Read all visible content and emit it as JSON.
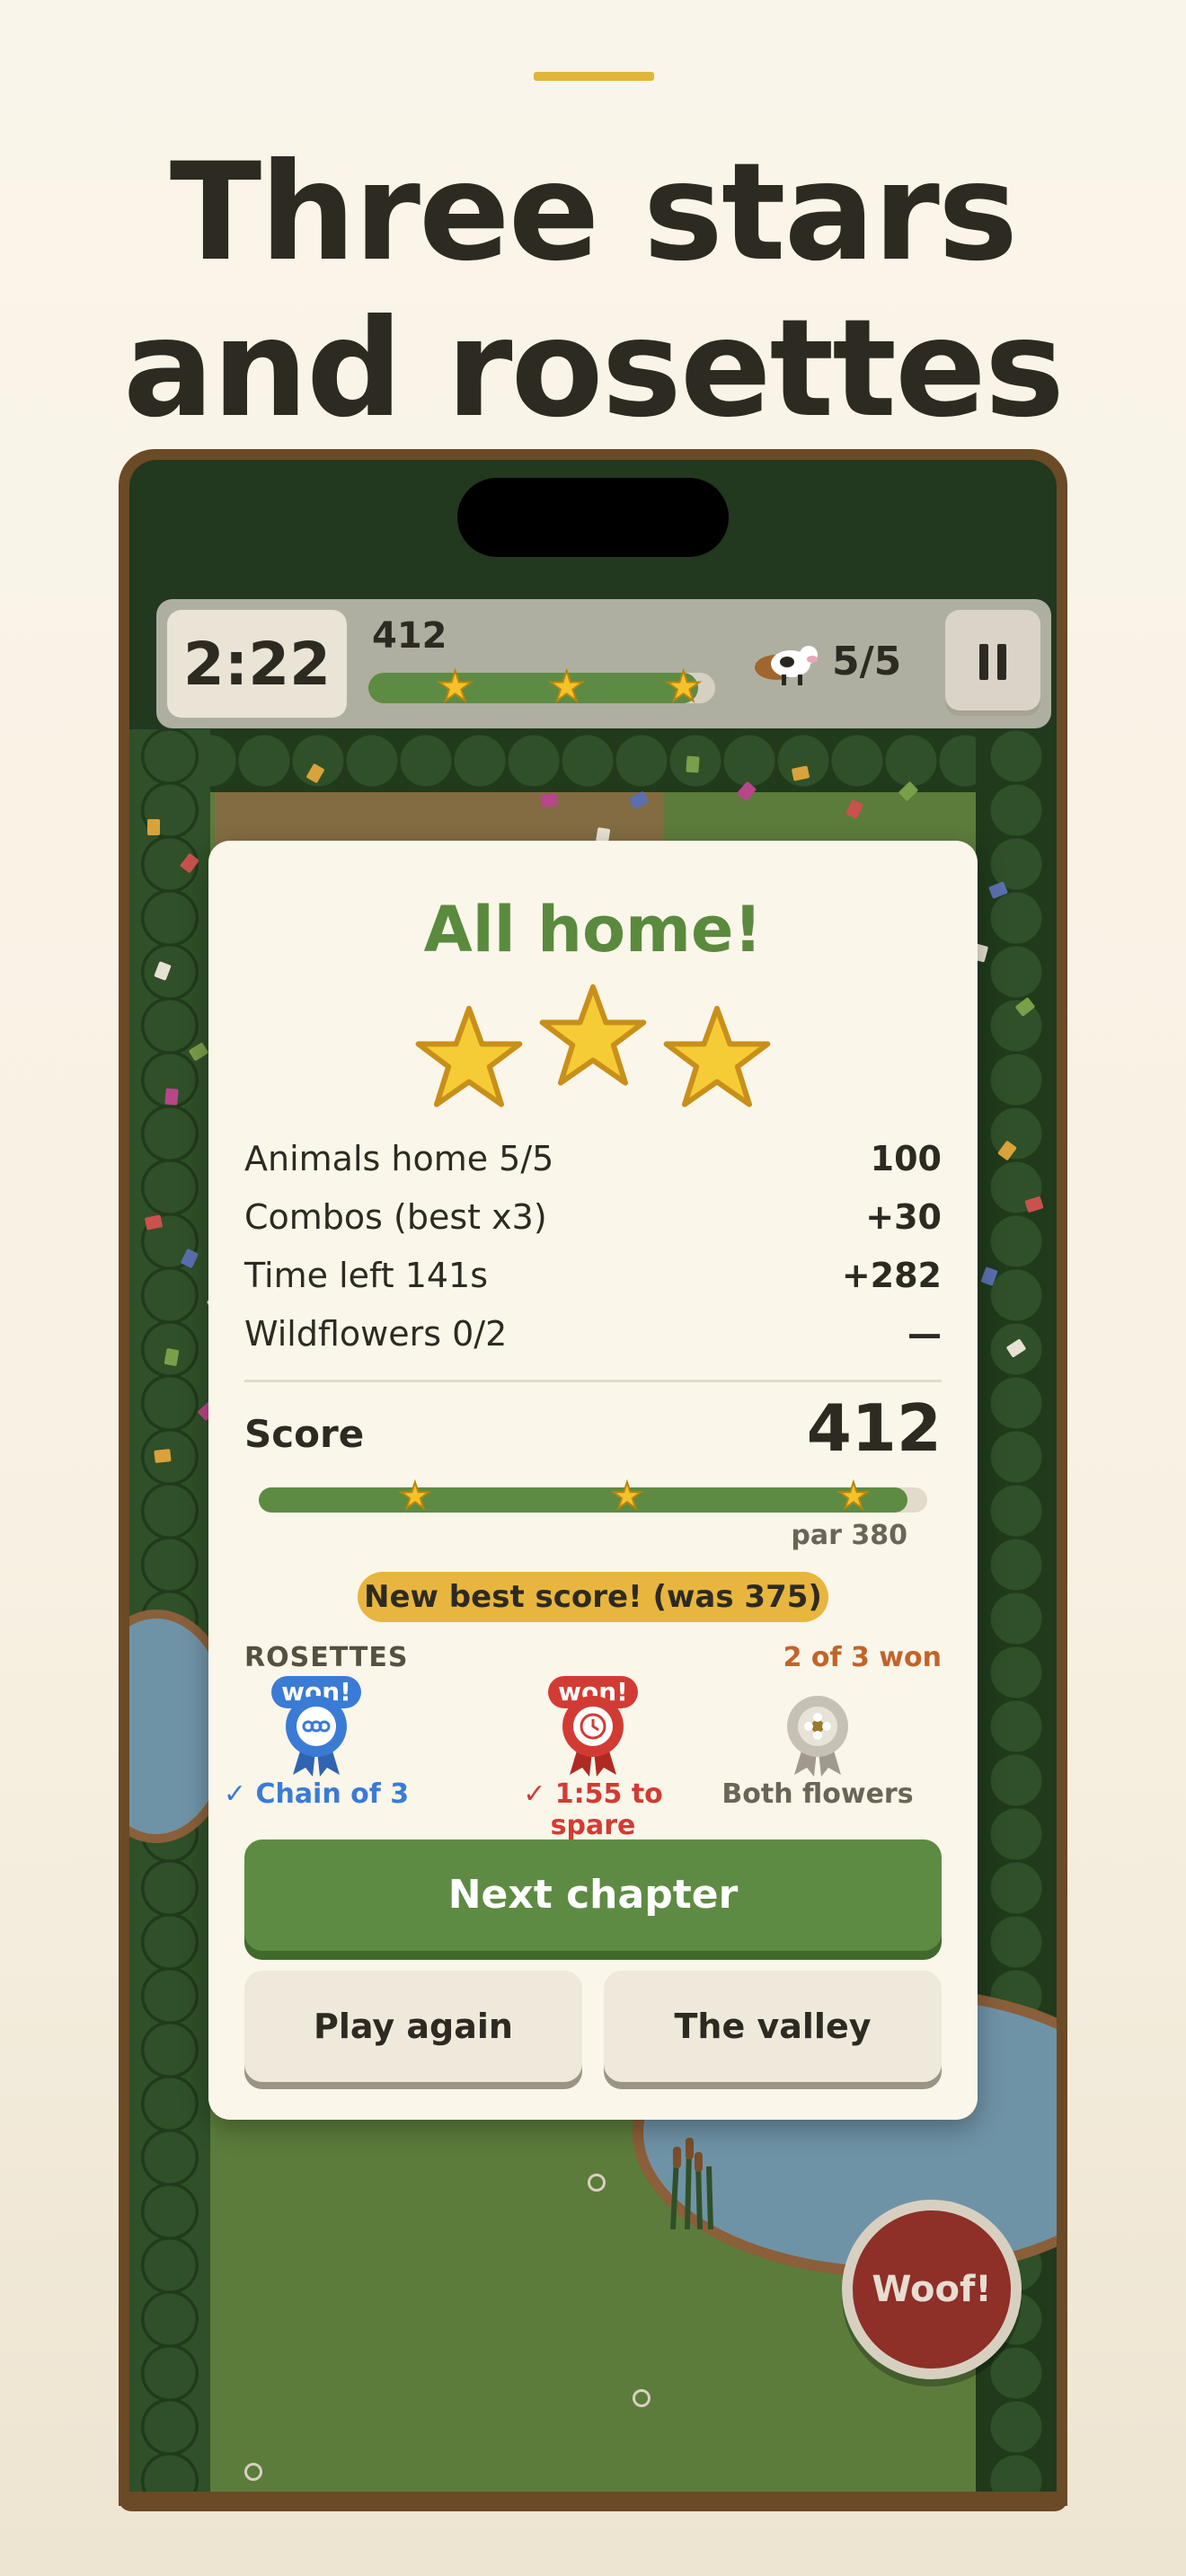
{
  "headline": {
    "line1": "Three stars",
    "line2": "and rosettes"
  },
  "hud": {
    "timer": "2:22",
    "score": "412",
    "animals": "5/5",
    "progress_fraction": 0.95,
    "star_icons": [
      "star-icon",
      "star-icon",
      "star-icon"
    ]
  },
  "results": {
    "title": "All home!",
    "stars_earned": 3,
    "rows": [
      {
        "label": "Animals home  5/5",
        "value": "100"
      },
      {
        "label": "Combos  (best x3)",
        "value": "+30"
      },
      {
        "label": "Time left  141s",
        "value": "+282"
      },
      {
        "label": "Wildflowers  0/2",
        "value": "—"
      }
    ],
    "score_label": "Score",
    "score_value": "412",
    "progress_fraction": 0.97,
    "par_label": "par 380",
    "best_banner": "New best score! (was 375)",
    "rosettes_title": "ROSETTES",
    "rosettes_count": "2 of 3 won",
    "rosettes": [
      {
        "badge": "won!",
        "caption": "✓ Chain of 3",
        "color": "#3a7bd5",
        "won": true,
        "icon": "chain-icon"
      },
      {
        "badge": "won!",
        "caption": "✓ 1:55 to spare",
        "color": "#d23b33",
        "won": true,
        "icon": "clock-icon"
      },
      {
        "badge": "",
        "caption": "Both flowers",
        "color": "#b5afa3",
        "won": false,
        "icon": "flower-icon"
      }
    ],
    "buttons": {
      "next": "Next chapter",
      "again": "Play again",
      "valley": "The valley"
    }
  },
  "woof_button": "Woof!",
  "colors": {
    "accent_green": "#5e8b43",
    "gold": "#e8b63e",
    "orange": "#c2642a",
    "blue": "#3a7bd5",
    "red": "#d23b33"
  }
}
